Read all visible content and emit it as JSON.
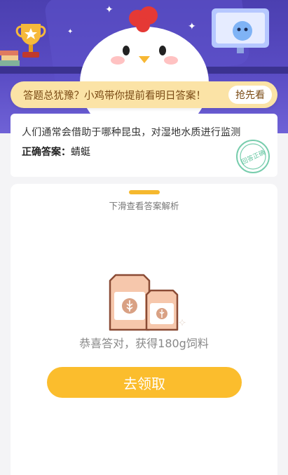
{
  "banner": {
    "text": "答题总犹豫？小鸡带你提前看明日答案！",
    "button_label": "抢先看"
  },
  "answer_card": {
    "question": "人们通常会借助于哪种昆虫，对湿地水质进行监测",
    "answer_label": "正确答案：",
    "answer_value": "蜻蜓",
    "stamp_text": "回答正确"
  },
  "sheet": {
    "hint": "下滑查看答案解析",
    "reward_text": "恭喜答对，获得180g饲料",
    "claim_label": "去领取"
  },
  "colors": {
    "accent_yellow": "#fbbd2d",
    "banner_bg": "#fbe3a6",
    "stamp_green": "#3fb88a",
    "hero_purple": "#5a4cc4"
  }
}
